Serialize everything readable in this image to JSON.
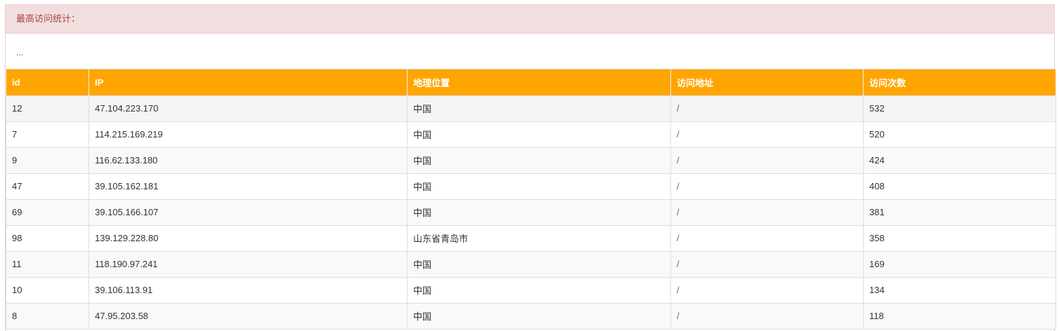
{
  "panel": {
    "title": "最高访问统计：",
    "body_text": "..."
  },
  "table": {
    "headers": [
      "id",
      "IP",
      "地理位置",
      "访问地址",
      "访问次数"
    ],
    "rows": [
      {
        "id": "12",
        "ip": "47.104.223.170",
        "geo": "中国",
        "url": "/",
        "count": "532"
      },
      {
        "id": "7",
        "ip": "114.215.169.219",
        "geo": "中国",
        "url": "/",
        "count": "520"
      },
      {
        "id": "9",
        "ip": "116.62.133.180",
        "geo": "中国",
        "url": "/",
        "count": "424"
      },
      {
        "id": "47",
        "ip": "39.105.162.181",
        "geo": "中国",
        "url": "/",
        "count": "408"
      },
      {
        "id": "69",
        "ip": "39.105.166.107",
        "geo": "中国",
        "url": "/",
        "count": "381"
      },
      {
        "id": "98",
        "ip": "139.129.228.80",
        "geo": "山东省青岛市",
        "url": "/",
        "count": "358"
      },
      {
        "id": "11",
        "ip": "118.190.97.241",
        "geo": "中国",
        "url": "/",
        "count": "169"
      },
      {
        "id": "10",
        "ip": "39.106.113.91",
        "geo": "中国",
        "url": "/",
        "count": "134"
      },
      {
        "id": "8",
        "ip": "47.95.203.58",
        "geo": "中国",
        "url": "/",
        "count": "118"
      }
    ]
  },
  "colors": {
    "heading_bg": "#f2dede",
    "heading_text": "#a94442",
    "table_header_bg": "#ffa500",
    "link": "#337ab7"
  }
}
